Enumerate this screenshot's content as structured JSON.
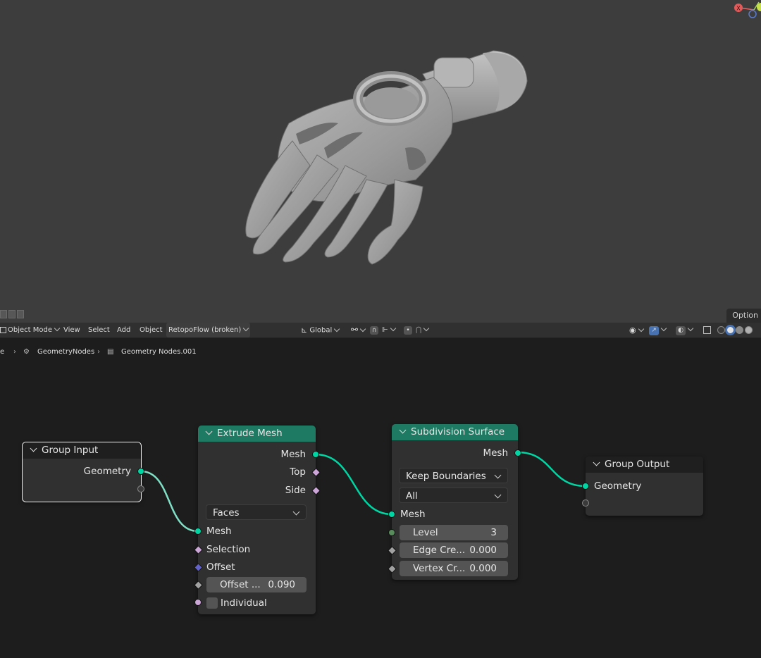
{
  "toolbar": {
    "mode": "Object Mode",
    "menus": [
      "View",
      "Select",
      "Add",
      "Object",
      "RetopoFlow (broken)"
    ],
    "orientation": "Global"
  },
  "viewport": {
    "options_label": "Option",
    "gizmo_x_label": "X"
  },
  "breadcrumb": {
    "items": [
      "e",
      "GeometryNodes",
      "Geometry Nodes.001"
    ]
  },
  "nodes": {
    "group_input": {
      "title": "Group Input",
      "outputs": [
        "Geometry"
      ]
    },
    "extrude_mesh": {
      "title": "Extrude Mesh",
      "outputs": [
        "Mesh",
        "Top",
        "Side"
      ],
      "mode": "Faces",
      "inputs": [
        "Mesh",
        "Selection",
        "Offset"
      ],
      "offset_scale_label": "Offset ...",
      "offset_scale_value": "0.090",
      "individual_label": "Individual"
    },
    "subdivision_surface": {
      "title": "Subdivision Surface",
      "outputs": [
        "Mesh"
      ],
      "boundary": "Keep Boundaries",
      "uv_smooth": "All",
      "inputs": [
        "Mesh"
      ],
      "level_label": "Level",
      "level_value": "3",
      "edge_crease_label": "Edge Cre...",
      "edge_crease_value": "0.000",
      "vertex_crease_label": "Vertex Cr...",
      "vertex_crease_value": "0.000"
    },
    "group_output": {
      "title": "Group Output",
      "inputs": [
        "Geometry"
      ]
    }
  },
  "colors": {
    "geometry_socket": "#00d6a3",
    "geometry_node_header": "#1e7a62",
    "viewport_bg": "#3d3d3d",
    "editor_bg": "#1d1d1d"
  }
}
